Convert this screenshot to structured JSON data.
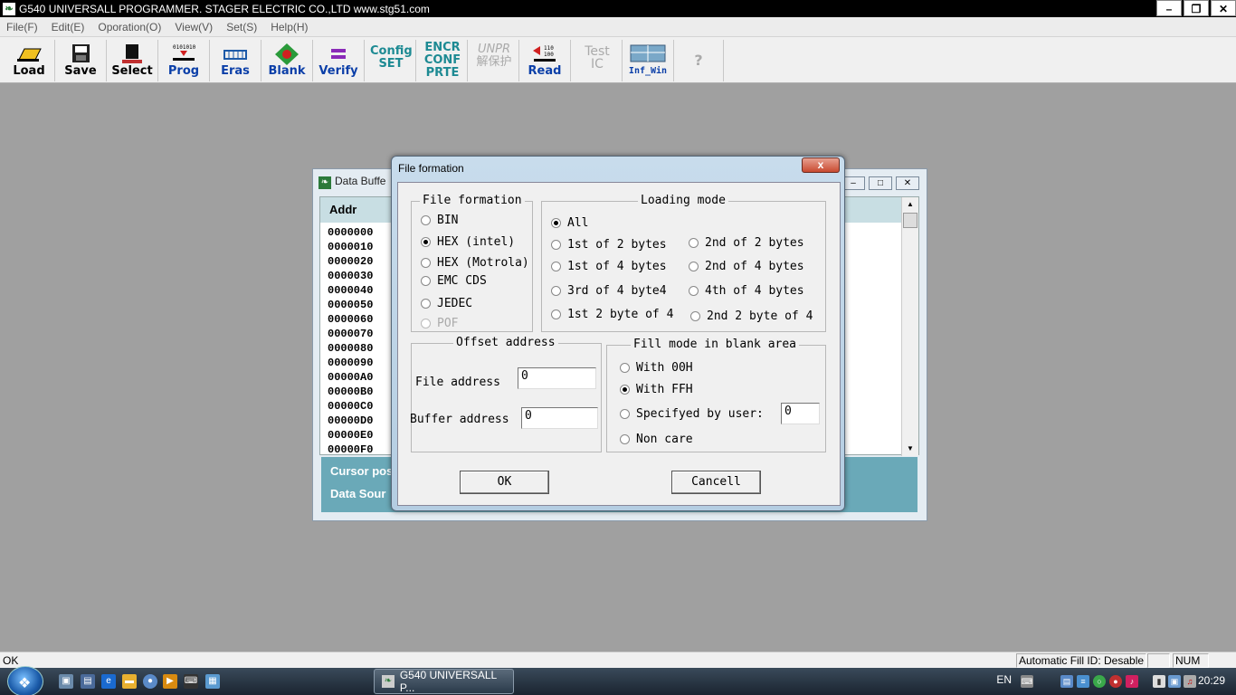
{
  "window": {
    "title": "G540 UNIVERSALL PROGRAMMER.  STAGER ELECTRIC CO.,LTD    www.stg51.com"
  },
  "menu": [
    "File(F)",
    "Edit(E)",
    "Oporation(O)",
    "View(V)",
    "Set(S)",
    "Help(H)"
  ],
  "toolbar": {
    "load": "Load",
    "save": "Save",
    "select": "Select",
    "prog": "Prog",
    "eras": "Eras",
    "blank": "Blank",
    "verify": "Verify",
    "config_line1": "Config",
    "config_line2": "SET",
    "encr_line1": "ENCR",
    "encr_line2": "CONF",
    "encr_line3": "PRTE",
    "unpr_line1": "UNPR",
    "unpr_line2": "解保护",
    "read": "Read",
    "test_line1": "Test",
    "test_line2": "IC",
    "infwin": "Inf_Win",
    "help": "?"
  },
  "data_buffer": {
    "title": "Data Buffe",
    "column_header": "Addr",
    "addresses": [
      "0000000",
      "0000010",
      "0000020",
      "0000030",
      "0000040",
      "0000050",
      "0000060",
      "0000070",
      "0000080",
      "0000090",
      "00000A0",
      "00000B0",
      "00000C0",
      "00000D0",
      "00000E0",
      "00000F0"
    ],
    "cursor_label": "Cursor pos",
    "source_label": "Data Sour"
  },
  "dialog": {
    "title": "File formation",
    "close": "x",
    "file_formation": {
      "title": "File formation",
      "options": [
        {
          "label": "BIN",
          "checked": false,
          "enabled": true
        },
        {
          "label": "HEX (intel)",
          "checked": true,
          "enabled": true
        },
        {
          "label": "HEX (Motrola)",
          "checked": false,
          "enabled": true
        },
        {
          "label": "EMC CDS",
          "checked": false,
          "enabled": true
        },
        {
          "label": "JEDEC",
          "checked": false,
          "enabled": true
        },
        {
          "label": "POF",
          "checked": false,
          "enabled": false
        }
      ]
    },
    "loading_mode": {
      "title": "Loading mode",
      "all": "All",
      "left": [
        "1st of 2 bytes",
        "1st of 4 bytes",
        "3rd of 4 byte4",
        "1st 2 byte of 4"
      ],
      "right": [
        "2nd of 2 bytes",
        "2nd of 4 bytes",
        "4th of 4 bytes",
        "2nd 2 byte of 4"
      ]
    },
    "offset": {
      "title": "Offset address",
      "file_label": "File address",
      "file_value": "0",
      "buffer_label": "Buffer address",
      "buffer_value": "0"
    },
    "fill_mode": {
      "title": "Fill mode in blank area",
      "with00": "With 00H",
      "withFF": "With FFH",
      "user": "Specifyed by user:",
      "user_value": "0",
      "noncare": "Non care"
    },
    "ok": "OK",
    "cancel": "Cancell"
  },
  "statusbar": {
    "left": "OK",
    "fill_id": "Automatic Fill ID: Desable",
    "num": "NUM"
  },
  "taskbar": {
    "task": "G540 UNIVERSALL P...",
    "lang": "EN",
    "clock": "20:29"
  },
  "colors": {
    "title_bar": "#000000",
    "grid_header": "#c8dee3",
    "status_panel": "#6aa9b8",
    "blue_label": "#0b3fa8",
    "teal_label": "#1d8a93"
  }
}
